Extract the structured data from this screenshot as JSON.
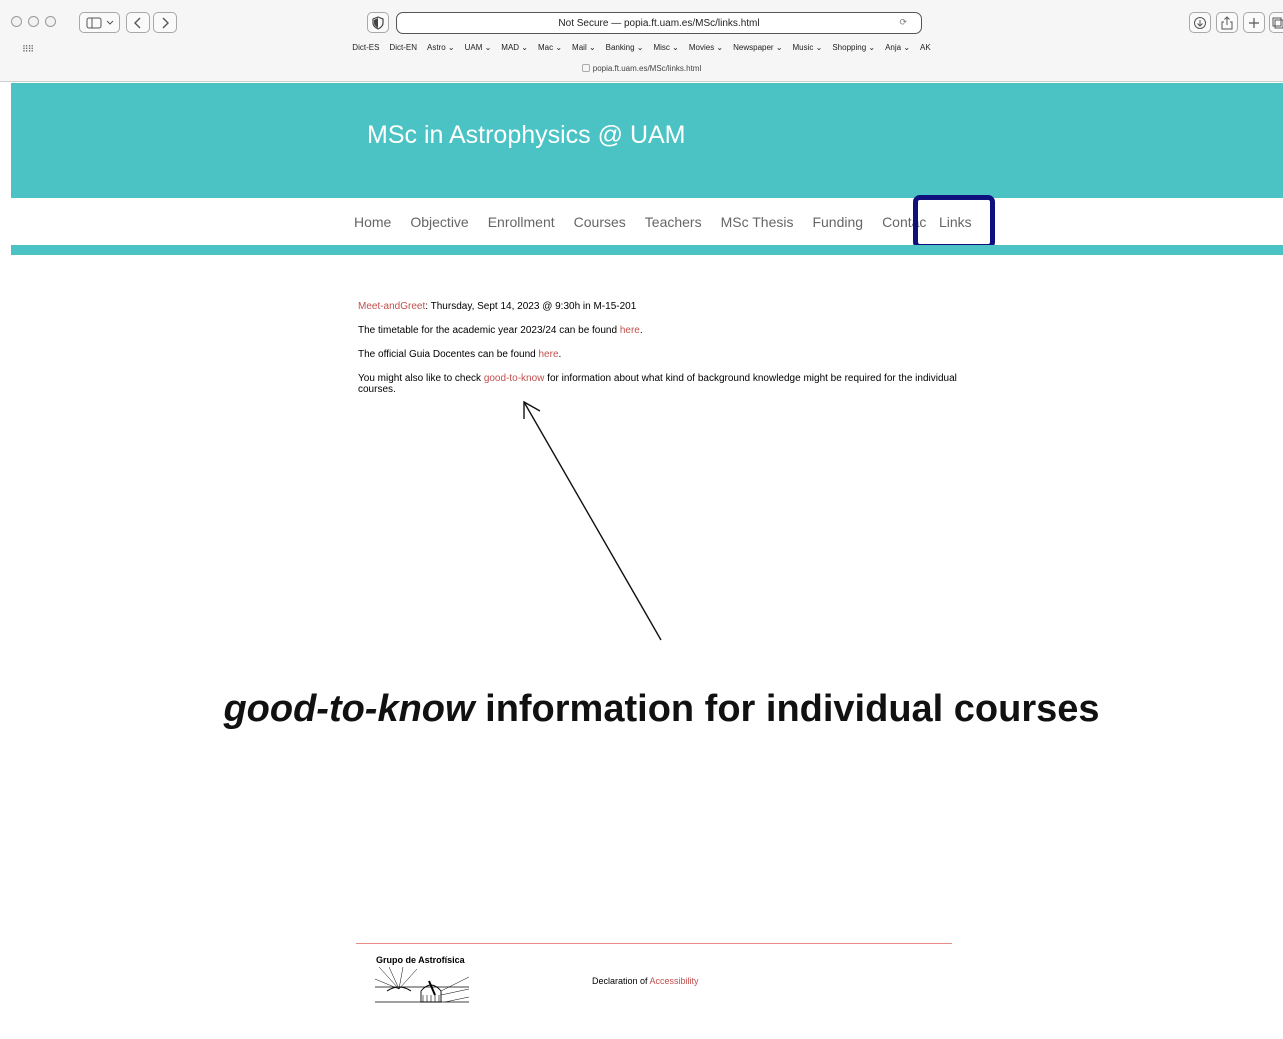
{
  "browser": {
    "address": "Not Secure — popia.ft.uam.es/MSc/links.html",
    "tab_url": "popia.ft.uam.es/MSc/links.html",
    "bookmarks": [
      "Dict-ES",
      "Dict-EN",
      "Astro ⌄",
      "UAM ⌄",
      "MAD ⌄",
      "Mac ⌄",
      "Mail ⌄",
      "Banking ⌄",
      "Misc ⌄",
      "Movies ⌄",
      "Newspaper ⌄",
      "Music ⌄",
      "Shopping ⌄",
      "Anja ⌄",
      "AK"
    ],
    "icons": {
      "sidebar": "sidebar-icon",
      "back": "chevron-left-icon",
      "forward": "chevron-right-icon",
      "shield": "shield-icon",
      "download": "download-icon",
      "share": "share-icon",
      "new_tab": "plus-icon",
      "tabs": "tabs-icon"
    }
  },
  "site": {
    "title": "MSc in Astrophysics @ UAM",
    "nav": [
      "Home",
      "Objective",
      "Enrollment",
      "Courses",
      "Teachers",
      "MSc Thesis",
      "Funding",
      "Contac"
    ],
    "nav_active": "Links",
    "accent_color": "#4bc3c5",
    "link_color": "#c0504d",
    "highlight_color": "#0f0f7e"
  },
  "content": {
    "meet_link": "Meet-andGreet",
    "meet_text": ": Thursday, Sept 14, 2023 @ 9:30h in M-15-201",
    "timetable_text": "The timetable for the academic year 2023/24 can be found ",
    "timetable_link": "here",
    "guia_text": "The official Guia Docentes can be found ",
    "guia_link": "here",
    "check_text_a": "You might also like to check ",
    "check_link": "good-to-know",
    "check_text_b": " for information about what kind of background knowledge might be required for the individual courses.",
    "period": "."
  },
  "annotation": {
    "emph": "good-to-know",
    "rest": " information for individual courses"
  },
  "footer": {
    "logo_text": "Grupo de Astrofísica",
    "decl_text": "Declaration of ",
    "decl_link": "Accessibility"
  }
}
